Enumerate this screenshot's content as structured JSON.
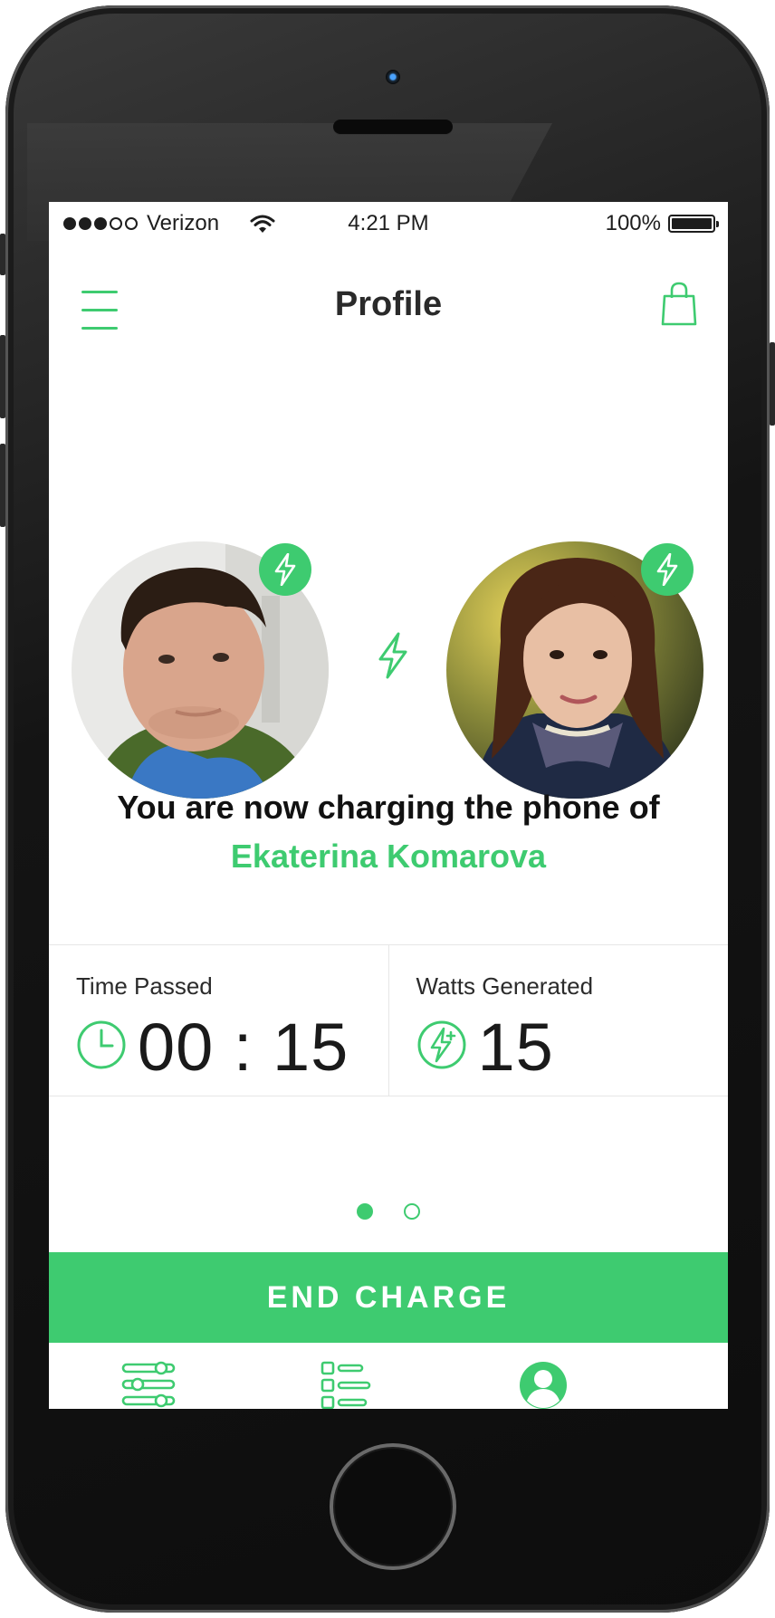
{
  "status_bar": {
    "signal_dots_full": 3,
    "signal_dots_empty": 2,
    "carrier": "Verizon",
    "time": "4:21 PM",
    "battery": "100%"
  },
  "nav": {
    "title": "Profile",
    "menu_icon": "hamburger-menu-icon",
    "cart_icon": "shopping-bag-icon"
  },
  "charging": {
    "headline": "You are now charging the phone of",
    "recipient_name": "Ekaterina Komarova"
  },
  "stats": {
    "time_label": "Time Passed",
    "time_value": "00 : 15",
    "watts_label": "Watts Generated",
    "watts_value": "15"
  },
  "pager": {
    "pages": 2,
    "active": 1
  },
  "actions": {
    "end_charge": "END CHARGE"
  },
  "tabs": [
    {
      "icon": "sliders-icon"
    },
    {
      "icon": "list-icon"
    },
    {
      "icon": "user-profile-icon"
    }
  ],
  "colors": {
    "accent": "#3ecb70",
    "text": "#1a1a1a",
    "divider": "#e6e6e6"
  }
}
